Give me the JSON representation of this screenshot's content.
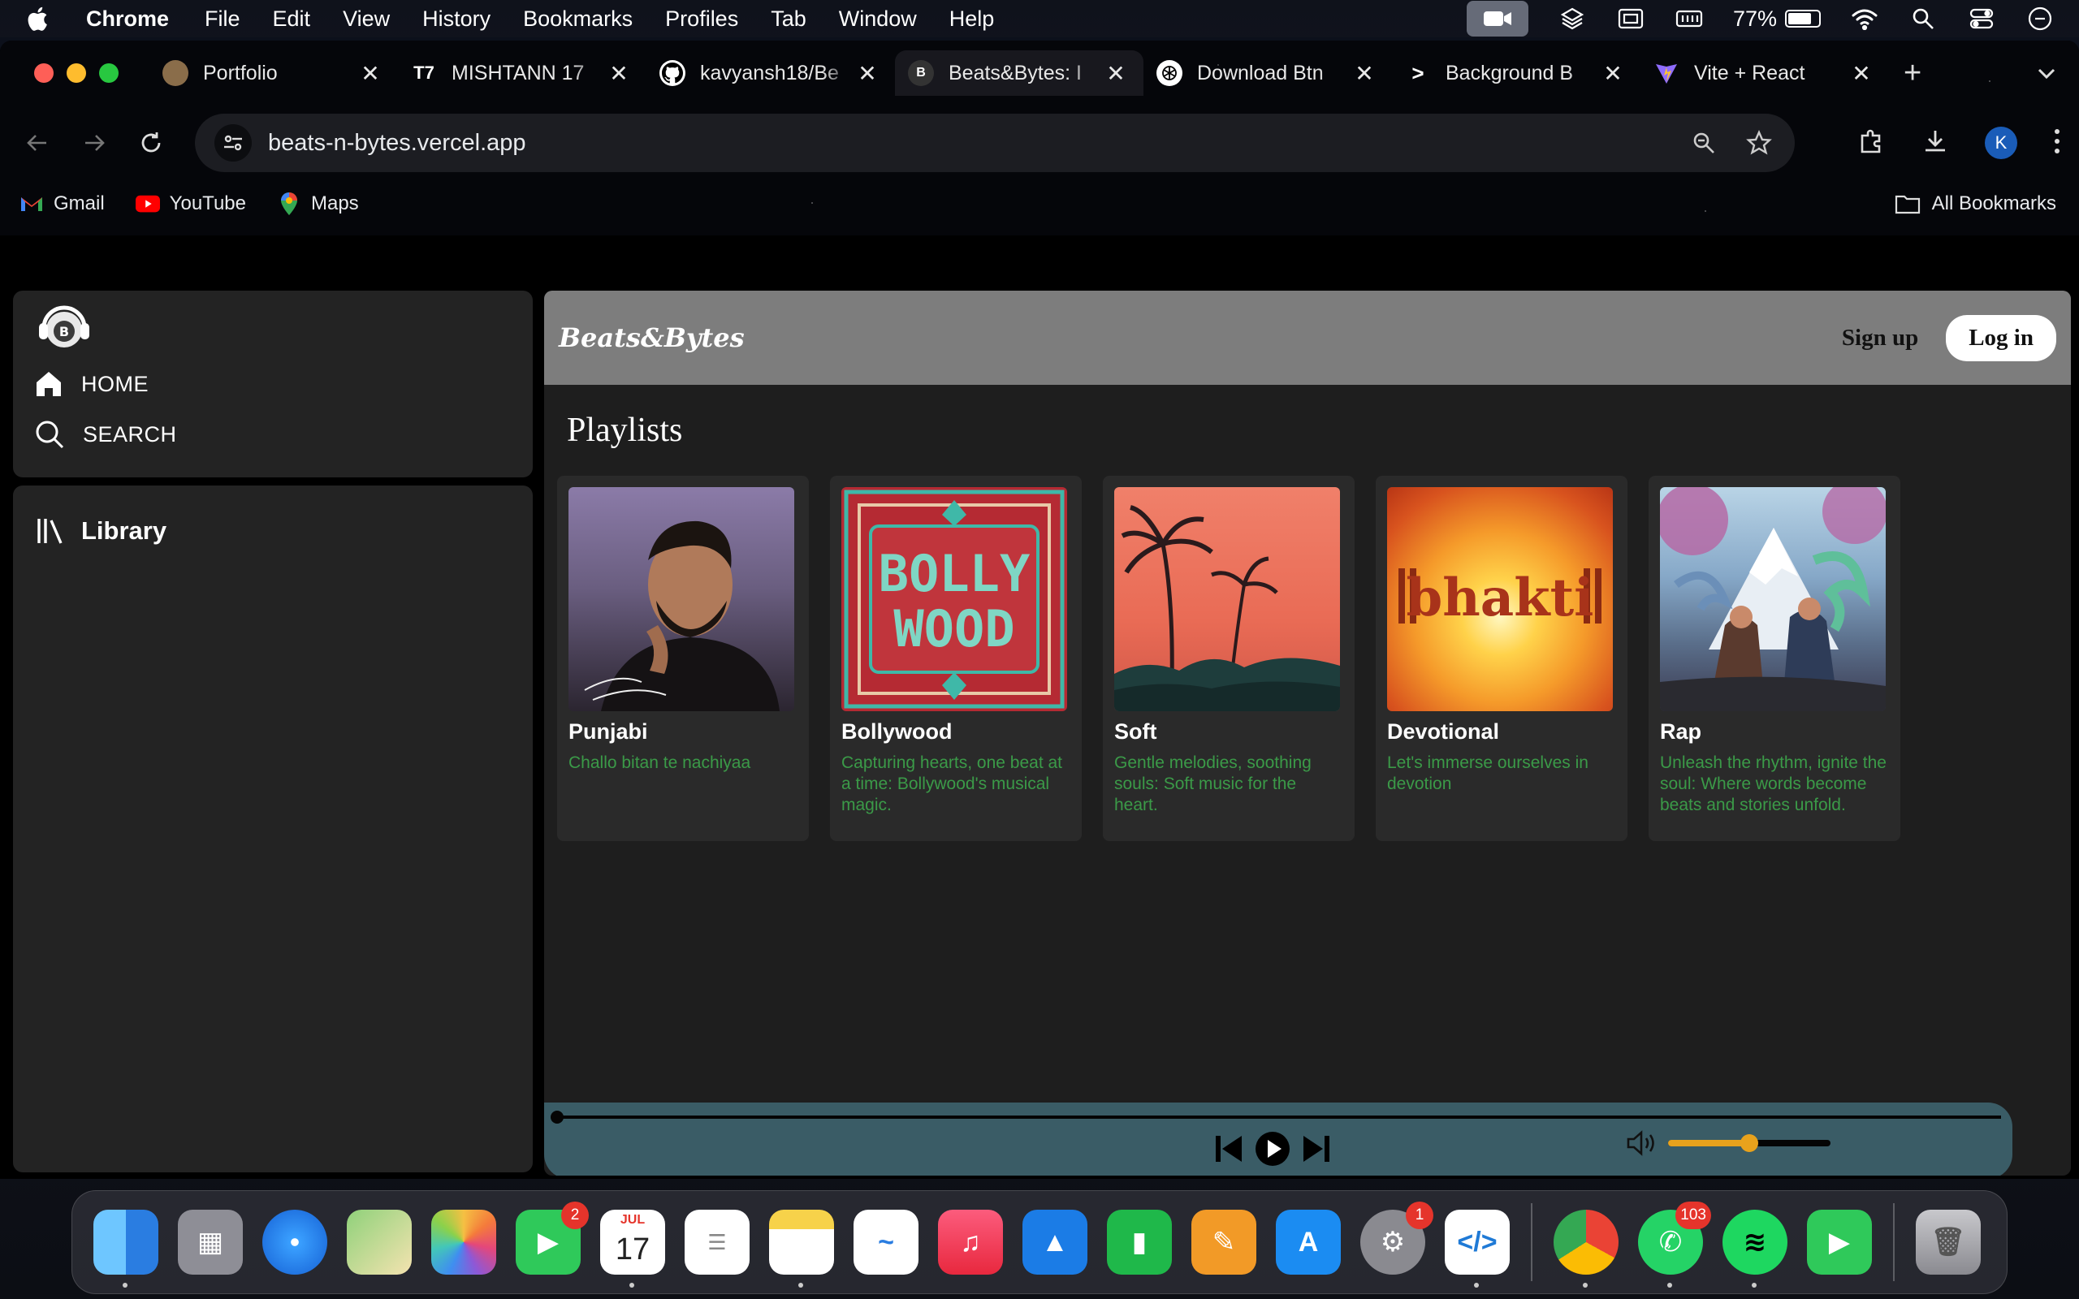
{
  "menubar": {
    "app_name": "Chrome",
    "items": [
      "File",
      "Edit",
      "View",
      "History",
      "Bookmarks",
      "Profiles",
      "Tab",
      "Window",
      "Help"
    ],
    "battery_percent": "77%",
    "battery_level": 0.77
  },
  "tabs": [
    {
      "title": "Portfolio",
      "icon": "portfolio-avatar-icon",
      "active": false
    },
    {
      "title": "MISHTANN 17",
      "icon": "tradingview-icon",
      "active": false
    },
    {
      "title": "kavyansh18/Be",
      "icon": "github-icon",
      "active": false
    },
    {
      "title": "Beats&Bytes: I",
      "icon": "beats-bytes-icon",
      "active": true
    },
    {
      "title": "Download Btn",
      "icon": "openai-icon",
      "active": false
    },
    {
      "title": "Background B",
      "icon": "terminal-chevron-icon",
      "active": false
    },
    {
      "title": "Vite + React",
      "icon": "vite-icon",
      "active": false
    }
  ],
  "toolbar": {
    "url": "beats-n-bytes.vercel.app",
    "profile_initial": "K"
  },
  "bookmarks": {
    "items": [
      {
        "label": "Gmail",
        "icon": "gmail-icon"
      },
      {
        "label": "YouTube",
        "icon": "youtube-icon"
      },
      {
        "label": "Maps",
        "icon": "maps-icon"
      }
    ],
    "all_label": "All Bookmarks"
  },
  "app": {
    "brand": "Beats&Bytes",
    "signup_label": "Sign up",
    "login_label": "Log in",
    "nav": {
      "home": "HOME",
      "search": "SEARCH",
      "library": "Library"
    },
    "section_title": "Playlists",
    "playlists": [
      {
        "title": "Punjabi",
        "description": "Challo bitan te nachiyaa"
      },
      {
        "title": "Bollywood",
        "description": "Capturing hearts, one beat at a time: Bollywood's musical magic."
      },
      {
        "title": "Soft",
        "description": "Gentle melodies, soothing souls: Soft music for the heart."
      },
      {
        "title": "Devotional",
        "description": "Let's immerse ourselves in devotion"
      },
      {
        "title": "Rap",
        "description": "Unleash the rhythm, ignite the soul: Where words become beats and stories unfold."
      }
    ],
    "bollywood_art_text": [
      "BOLLY",
      "WOOD"
    ],
    "bhakti_art_text": "bhakti",
    "player": {
      "progress": 0.0,
      "volume": 0.5
    }
  },
  "colors": {
    "accent_green": "#3b9a48",
    "player_bg": "#3a5c66",
    "volume_orange": "#e8a21c",
    "header_gray": "#7d7d7d"
  },
  "dock": {
    "apps": [
      {
        "name": "Finder",
        "icon": "finder-icon"
      },
      {
        "name": "Launchpad",
        "icon": "launchpad-icon"
      },
      {
        "name": "Safari",
        "icon": "safari-icon"
      },
      {
        "name": "Maps",
        "icon": "maps-app-icon"
      },
      {
        "name": "Photos",
        "icon": "photos-icon"
      },
      {
        "name": "FaceTime",
        "icon": "facetime-icon",
        "badge": "2"
      },
      {
        "name": "Calendar",
        "icon": "calendar-icon",
        "month": "JUL",
        "day": "17"
      },
      {
        "name": "Reminders",
        "icon": "reminders-icon"
      },
      {
        "name": "Notes",
        "icon": "notes-icon"
      },
      {
        "name": "Freeform",
        "icon": "freeform-icon"
      },
      {
        "name": "Music",
        "icon": "music-icon"
      },
      {
        "name": "Keynote",
        "icon": "keynote-icon"
      },
      {
        "name": "Numbers",
        "icon": "numbers-icon"
      },
      {
        "name": "Pages",
        "icon": "pages-icon"
      },
      {
        "name": "App Store",
        "icon": "app-store-icon"
      },
      {
        "name": "System Settings",
        "icon": "system-settings-icon",
        "badge": "1"
      },
      {
        "name": "VS Code",
        "icon": "vscode-icon"
      },
      {
        "name": "Chrome",
        "icon": "chrome-icon"
      },
      {
        "name": "WhatsApp",
        "icon": "whatsapp-icon",
        "badge": "103"
      },
      {
        "name": "Spotify",
        "icon": "spotify-icon"
      },
      {
        "name": "FaceTime",
        "icon": "facetime-recent-icon"
      },
      {
        "name": "Trash",
        "icon": "trash-icon"
      }
    ]
  }
}
